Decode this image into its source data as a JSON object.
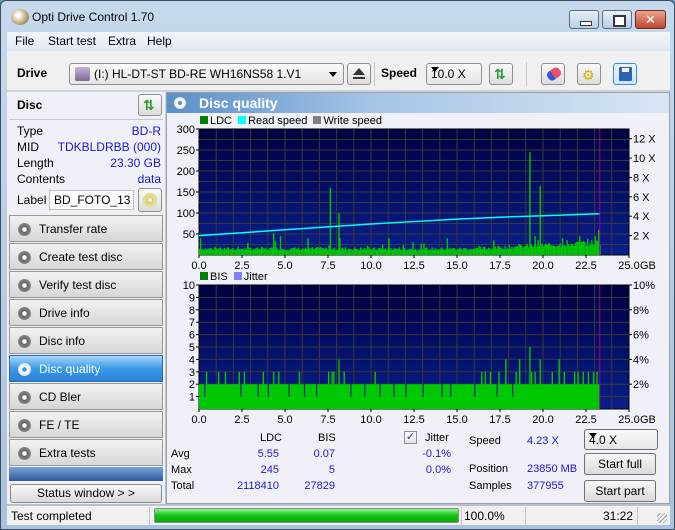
{
  "window": {
    "title": "Opti Drive Control 1.70",
    "controls": {
      "minimize": "minimize",
      "maximize": "maximize",
      "close": "✕"
    }
  },
  "menu": [
    "File",
    "Start test",
    "Extra",
    "Help"
  ],
  "toolbar": {
    "drive_label": "Drive",
    "drive_value": "(I:)   HL-DT-ST BD-RE  WH16NS58 1.V1",
    "speed_label": "Speed",
    "speed_value": "10.0 X"
  },
  "disc": {
    "title": "Disc",
    "rows": [
      {
        "key": "Type",
        "value": "BD-R"
      },
      {
        "key": "MID",
        "value": "TDKBLDRBB (000)"
      },
      {
        "key": "Length",
        "value": "23.30 GB"
      },
      {
        "key": "Contents",
        "value": "data"
      }
    ],
    "label_key": "Label",
    "label_value": "BD_FOTO_13"
  },
  "nav": [
    {
      "label": "Transfer rate",
      "active": false
    },
    {
      "label": "Create test disc",
      "active": false
    },
    {
      "label": "Verify test disc",
      "active": false
    },
    {
      "label": "Drive info",
      "active": false
    },
    {
      "label": "Disc info",
      "active": false
    },
    {
      "label": "Disc quality",
      "active": true
    },
    {
      "label": "CD Bler",
      "active": false
    },
    {
      "label": "FE / TE",
      "active": false
    },
    {
      "label": "Extra tests",
      "active": false
    }
  ],
  "status_window_button": "Status window > >",
  "main": {
    "title": "Disc quality",
    "stats": {
      "col_ldc": "LDC",
      "col_bis": "BIS",
      "jitter_label": "Jitter",
      "jitter_checked": true,
      "rows": [
        {
          "label": "Avg",
          "ldc": "5.55",
          "bis": "0.07",
          "jitter": "-0.1%"
        },
        {
          "label": "Max",
          "ldc": "245",
          "bis": "5",
          "jitter": "0.0%"
        },
        {
          "label": "Total",
          "ldc": "2118410",
          "bis": "27829",
          "jitter": ""
        }
      ],
      "speed_label": "Speed",
      "speed_value": "4.23 X",
      "position_label": "Position",
      "position_value": "23850 MB",
      "samples_label": "Samples",
      "samples_value": "377955"
    },
    "test_speed": "4.0 X",
    "start_full": "Start full",
    "start_part": "Start part"
  },
  "statusbar": {
    "text": "Test completed",
    "progress": 1.0,
    "percent": "100.0%",
    "time": "31:22"
  },
  "colors": {
    "ldc": "#00c800",
    "read_speed": "#00ffff",
    "write_speed": "#808080",
    "bis": "#00c800",
    "jitter": "#8080ff",
    "plot_bg_top": "#000040",
    "plot_bg_bottom": "#0a1e8c",
    "end_marker": "#a000a0"
  },
  "chart_data": [
    {
      "type": "bar",
      "title": "LDC / Read speed",
      "legend": [
        "LDC",
        "Read speed",
        "Write speed"
      ],
      "legend_position": "top-left",
      "x_ticks": [
        "0.0",
        "2.5",
        "5.0",
        "7.5",
        "10.0",
        "12.5",
        "15.0",
        "17.5",
        "20.0",
        "22.5",
        "25.0"
      ],
      "x_unit": "GB",
      "xlim": [
        0,
        25
      ],
      "ylim_left": [
        0,
        300
      ],
      "y_ticks_left": [
        50,
        100,
        150,
        200,
        250,
        300
      ],
      "ylim_right": [
        0,
        13
      ],
      "y_ticks_right": [
        "2 X",
        "4 X",
        "6 X",
        "8 X",
        "10 X",
        "12 X"
      ],
      "grid": true,
      "data_end_gb": 23.3,
      "ldc_baseline": 15,
      "ldc_spikes": [
        {
          "x": 0.05,
          "y": 40
        },
        {
          "x": 4.3,
          "y": 52
        },
        {
          "x": 4.4,
          "y": 33
        },
        {
          "x": 4.7,
          "y": 45
        },
        {
          "x": 6.3,
          "y": 40
        },
        {
          "x": 7.6,
          "y": 160
        },
        {
          "x": 8.1,
          "y": 100
        },
        {
          "x": 8.15,
          "y": 40
        },
        {
          "x": 11.0,
          "y": 40
        },
        {
          "x": 12.4,
          "y": 30
        },
        {
          "x": 14.4,
          "y": 40
        },
        {
          "x": 17.1,
          "y": 35
        },
        {
          "x": 19.2,
          "y": 245
        },
        {
          "x": 19.5,
          "y": 45
        },
        {
          "x": 19.8,
          "y": 165
        },
        {
          "x": 21.1,
          "y": 40
        },
        {
          "x": 22.1,
          "y": 45
        },
        {
          "x": 23.0,
          "y": 45
        },
        {
          "x": 23.2,
          "y": 60
        }
      ],
      "ldc_end_level": 30,
      "read_speed": [
        {
          "x": 0,
          "y": 2.0
        },
        {
          "x": 2.5,
          "y": 2.3
        },
        {
          "x": 5.0,
          "y": 2.6
        },
        {
          "x": 7.5,
          "y": 2.9
        },
        {
          "x": 10.0,
          "y": 3.2
        },
        {
          "x": 12.5,
          "y": 3.45
        },
        {
          "x": 15.0,
          "y": 3.7
        },
        {
          "x": 17.5,
          "y": 3.9
        },
        {
          "x": 20.0,
          "y": 4.05
        },
        {
          "x": 23.3,
          "y": 4.25
        }
      ]
    },
    {
      "type": "bar",
      "title": "BIS / Jitter",
      "legend": [
        "BIS",
        "Jitter"
      ],
      "legend_position": "top-left",
      "x_ticks": [
        "0.0",
        "2.5",
        "5.0",
        "7.5",
        "10.0",
        "12.5",
        "15.0",
        "17.5",
        "20.0",
        "22.5",
        "25.0"
      ],
      "x_unit": "GB",
      "xlim": [
        0,
        25
      ],
      "ylim_left": [
        0,
        10
      ],
      "y_ticks_left": [
        1,
        2,
        3,
        4,
        5,
        6,
        7,
        8,
        9,
        10
      ],
      "ylim_right": [
        0,
        10
      ],
      "y_ticks_right": [
        "2%",
        "4%",
        "6%",
        "8%",
        "10%"
      ],
      "grid": true,
      "data_end_gb": 23.3,
      "bis_baseline": 2,
      "bis_level3_x": [
        0.4,
        1.1,
        1.5,
        2.3,
        2.6,
        3.7,
        4.3,
        4.6,
        5.8,
        7.5,
        7.7,
        7.8,
        8.4,
        10.2,
        16.4,
        16.6,
        16.9,
        17.4,
        18.4,
        18.6,
        19.3,
        19.5,
        20.5,
        20.9,
        21.2,
        21.8,
        22.0,
        22.3,
        22.6,
        22.9,
        23.1
      ],
      "bis_level4_x": [
        8.1,
        17.8,
        18.6,
        19.8,
        20.9
      ],
      "bis_level5_x": [
        19.2
      ],
      "bis_gaps_x": [
        0.3,
        2.4,
        3.4,
        4.0,
        5.2,
        6.1,
        6.8,
        8.8,
        9.6,
        10.5,
        11.3,
        12.0,
        13.0,
        14.1,
        14.6,
        16.0,
        17.3,
        18.2
      ]
    }
  ]
}
